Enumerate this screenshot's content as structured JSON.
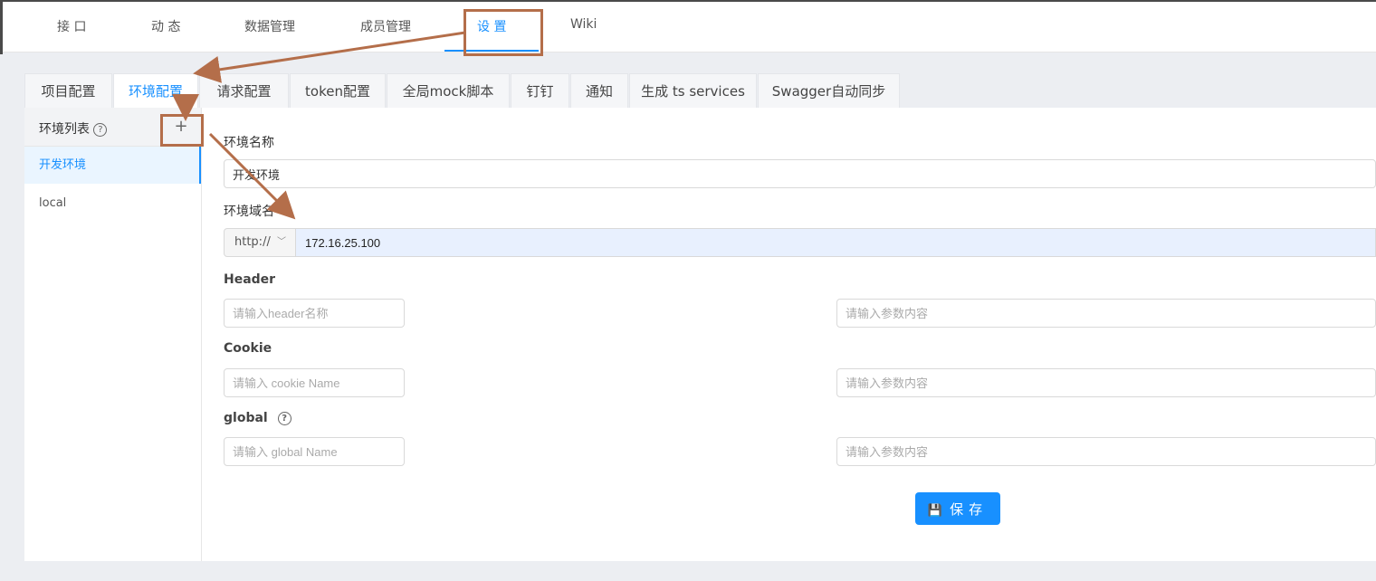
{
  "nav": {
    "items": [
      {
        "label": "接 口"
      },
      {
        "label": "动 态"
      },
      {
        "label": "数据管理"
      },
      {
        "label": "成员管理"
      },
      {
        "label": "设 置"
      },
      {
        "label": "Wiki"
      }
    ],
    "active_index": 4
  },
  "settings_tabs": [
    {
      "label": "项目配置"
    },
    {
      "label": "环境配置"
    },
    {
      "label": "请求配置"
    },
    {
      "label": "token配置"
    },
    {
      "label": "全局mock脚本"
    },
    {
      "label": "钉钉"
    },
    {
      "label": "通知"
    },
    {
      "label": "生成 ts services"
    },
    {
      "label": "Swagger自动同步"
    }
  ],
  "sidebar": {
    "title": "环境列表",
    "help_icon": "question-circle-icon",
    "add_icon": "plus-icon",
    "add_label": "+",
    "environments": [
      {
        "label": "开发环境",
        "active": true
      },
      {
        "label": "local",
        "active": false
      }
    ]
  },
  "form": {
    "env_name_label": "环境名称",
    "env_name_value": "开发环境",
    "domain_label": "环境域名",
    "protocol": "http://",
    "domain_value": "172.16.25.100",
    "header_label": "Header",
    "header_name_placeholder": "请输入header名称",
    "header_value_placeholder": "请输入参数内容",
    "cookie_label": "Cookie",
    "cookie_name_placeholder": "请输入 cookie Name",
    "cookie_value_placeholder": "请输入参数内容",
    "global_label": "global",
    "global_name_placeholder": "请输入 global Name",
    "global_value_placeholder": "请输入参数内容",
    "save_label": "保存",
    "save_icon": "save-icon"
  },
  "colors": {
    "accent": "#1890ff",
    "annotation": "#b46e4a"
  }
}
